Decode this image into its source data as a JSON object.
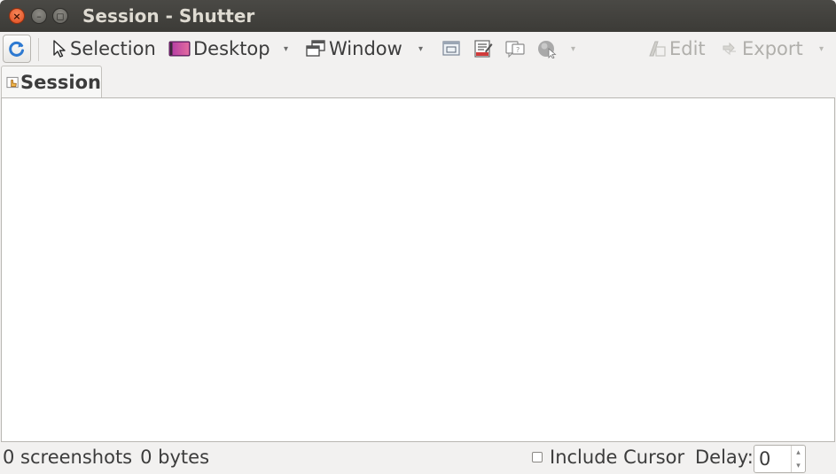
{
  "window": {
    "title": "Session - Shutter",
    "controls": {
      "close": "×",
      "minimize": "–",
      "maximize": "◻"
    }
  },
  "toolbar": {
    "refresh_icon": "refresh-icon",
    "selection_label": "Selection",
    "desktop_label": "Desktop",
    "window_label": "Window",
    "edit_label": "Edit",
    "export_label": "Export",
    "dropdown_glyph": "▾",
    "icons": [
      "window-section-icon",
      "menu-capture-icon",
      "tooltip-capture-icon",
      "web-capture-icon"
    ]
  },
  "tabs": [
    {
      "label": "Session",
      "icon": "session-hand-icon"
    }
  ],
  "status": {
    "screenshots": "0 screenshots",
    "size": "0 bytes",
    "include_cursor_label": "Include Cursor",
    "include_cursor_checked": false,
    "delay_label": "Delay:",
    "delay_value": "0",
    "spin_up": "▴",
    "spin_down": "▾"
  },
  "colors": {
    "titlebar": "#3c3b37",
    "title_text": "#dfdbd2",
    "close_button": "#e95420",
    "background": "#f2f1f0",
    "disabled_text": "#b0afab"
  }
}
